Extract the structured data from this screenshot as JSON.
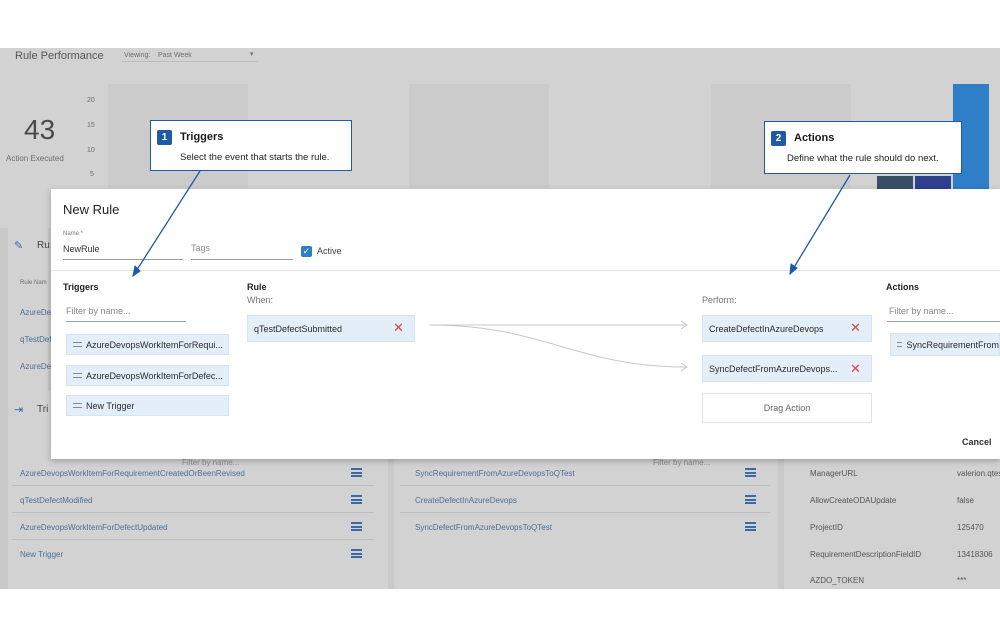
{
  "background": {
    "perf_title": "Rule Performance",
    "viewing_label": "Viewing:",
    "viewing_value": "Past Week",
    "metric_value": "43",
    "metric_label": "Action Executed",
    "y_ticks": [
      "20",
      "15",
      "10",
      "5"
    ],
    "rules_section_title": "Ru",
    "rule_name_header": "Rule Nam",
    "rule_names_partial": [
      "AzureDev",
      "qTestDef",
      "AzureDev"
    ],
    "triggers_section_title": "Tri",
    "filter_placeholder_left": "Filter by name...",
    "filter_placeholder_mid": "Filter by name...",
    "triggers_list": [
      "AzureDevopsWorkItemForRequirementCreatedOrBeenRevised",
      "qTestDefectModified",
      "AzureDevopsWorkItemForDefectUpdated",
      "New Trigger"
    ],
    "actions_list": [
      "SyncRequirementFromAzureDevopsToQTest",
      "CreateDefectInAzureDevops",
      "SyncDefectFromAzureDevopsToQTest"
    ],
    "properties": [
      {
        "key": "ManagerURL",
        "value": "valerion.qtes"
      },
      {
        "key": "AllowCreateODAUpdate",
        "value": "false"
      },
      {
        "key": "ProjectID",
        "value": "125470"
      },
      {
        "key": "RequirementDescriptionFieldID",
        "value": "13418306"
      },
      {
        "key": "AZDO_TOKEN",
        "value": "***"
      }
    ]
  },
  "modal": {
    "title": "New Rule",
    "name_label": "Name *",
    "name_value": "NewRule",
    "tags_placeholder": "Tags",
    "active_label": "Active",
    "triggers_title": "Triggers",
    "triggers_filter_placeholder": "Filter by name...",
    "triggers": [
      "AzureDevopsWorkItemForRequi...",
      "AzureDevopsWorkItemForDefec...",
      "New Trigger"
    ],
    "rule_title": "Rule",
    "when_label": "When:",
    "when_trigger": "qTestDefectSubmitted",
    "perform_label": "Perform:",
    "perform_actions": [
      "CreateDefectInAzureDevops",
      "SyncDefectFromAzureDevops..."
    ],
    "drag_action_label": "Drag Action",
    "actions_title": "Actions",
    "actions_filter_placeholder": "Filter by name...",
    "actions": [
      "SyncRequirementFrom"
    ],
    "cancel_label": "Cancel"
  },
  "callouts": [
    {
      "number": "1",
      "title": "Triggers",
      "text": "Select the event that starts the rule."
    },
    {
      "number": "2",
      "title": "Actions",
      "text": "Define what the rule should do next."
    }
  ],
  "colors": {
    "accent": "#1f5aa6",
    "chip_bg": "#e4eef8",
    "remove": "#d64545",
    "overlay": "#c9c9c9"
  }
}
